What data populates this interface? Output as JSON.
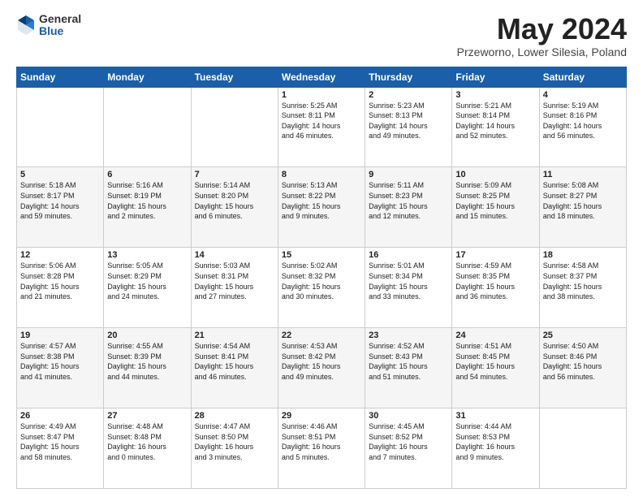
{
  "header": {
    "logo_general": "General",
    "logo_blue": "Blue",
    "month": "May 2024",
    "location": "Przeworno, Lower Silesia, Poland"
  },
  "weekdays": [
    "Sunday",
    "Monday",
    "Tuesday",
    "Wednesday",
    "Thursday",
    "Friday",
    "Saturday"
  ],
  "weeks": [
    [
      {
        "day": "",
        "info": ""
      },
      {
        "day": "",
        "info": ""
      },
      {
        "day": "",
        "info": ""
      },
      {
        "day": "1",
        "info": "Sunrise: 5:25 AM\nSunset: 8:11 PM\nDaylight: 14 hours\nand 46 minutes."
      },
      {
        "day": "2",
        "info": "Sunrise: 5:23 AM\nSunset: 8:13 PM\nDaylight: 14 hours\nand 49 minutes."
      },
      {
        "day": "3",
        "info": "Sunrise: 5:21 AM\nSunset: 8:14 PM\nDaylight: 14 hours\nand 52 minutes."
      },
      {
        "day": "4",
        "info": "Sunrise: 5:19 AM\nSunset: 8:16 PM\nDaylight: 14 hours\nand 56 minutes."
      }
    ],
    [
      {
        "day": "5",
        "info": "Sunrise: 5:18 AM\nSunset: 8:17 PM\nDaylight: 14 hours\nand 59 minutes."
      },
      {
        "day": "6",
        "info": "Sunrise: 5:16 AM\nSunset: 8:19 PM\nDaylight: 15 hours\nand 2 minutes."
      },
      {
        "day": "7",
        "info": "Sunrise: 5:14 AM\nSunset: 8:20 PM\nDaylight: 15 hours\nand 6 minutes."
      },
      {
        "day": "8",
        "info": "Sunrise: 5:13 AM\nSunset: 8:22 PM\nDaylight: 15 hours\nand 9 minutes."
      },
      {
        "day": "9",
        "info": "Sunrise: 5:11 AM\nSunset: 8:23 PM\nDaylight: 15 hours\nand 12 minutes."
      },
      {
        "day": "10",
        "info": "Sunrise: 5:09 AM\nSunset: 8:25 PM\nDaylight: 15 hours\nand 15 minutes."
      },
      {
        "day": "11",
        "info": "Sunrise: 5:08 AM\nSunset: 8:27 PM\nDaylight: 15 hours\nand 18 minutes."
      }
    ],
    [
      {
        "day": "12",
        "info": "Sunrise: 5:06 AM\nSunset: 8:28 PM\nDaylight: 15 hours\nand 21 minutes."
      },
      {
        "day": "13",
        "info": "Sunrise: 5:05 AM\nSunset: 8:29 PM\nDaylight: 15 hours\nand 24 minutes."
      },
      {
        "day": "14",
        "info": "Sunrise: 5:03 AM\nSunset: 8:31 PM\nDaylight: 15 hours\nand 27 minutes."
      },
      {
        "day": "15",
        "info": "Sunrise: 5:02 AM\nSunset: 8:32 PM\nDaylight: 15 hours\nand 30 minutes."
      },
      {
        "day": "16",
        "info": "Sunrise: 5:01 AM\nSunset: 8:34 PM\nDaylight: 15 hours\nand 33 minutes."
      },
      {
        "day": "17",
        "info": "Sunrise: 4:59 AM\nSunset: 8:35 PM\nDaylight: 15 hours\nand 36 minutes."
      },
      {
        "day": "18",
        "info": "Sunrise: 4:58 AM\nSunset: 8:37 PM\nDaylight: 15 hours\nand 38 minutes."
      }
    ],
    [
      {
        "day": "19",
        "info": "Sunrise: 4:57 AM\nSunset: 8:38 PM\nDaylight: 15 hours\nand 41 minutes."
      },
      {
        "day": "20",
        "info": "Sunrise: 4:55 AM\nSunset: 8:39 PM\nDaylight: 15 hours\nand 44 minutes."
      },
      {
        "day": "21",
        "info": "Sunrise: 4:54 AM\nSunset: 8:41 PM\nDaylight: 15 hours\nand 46 minutes."
      },
      {
        "day": "22",
        "info": "Sunrise: 4:53 AM\nSunset: 8:42 PM\nDaylight: 15 hours\nand 49 minutes."
      },
      {
        "day": "23",
        "info": "Sunrise: 4:52 AM\nSunset: 8:43 PM\nDaylight: 15 hours\nand 51 minutes."
      },
      {
        "day": "24",
        "info": "Sunrise: 4:51 AM\nSunset: 8:45 PM\nDaylight: 15 hours\nand 54 minutes."
      },
      {
        "day": "25",
        "info": "Sunrise: 4:50 AM\nSunset: 8:46 PM\nDaylight: 15 hours\nand 56 minutes."
      }
    ],
    [
      {
        "day": "26",
        "info": "Sunrise: 4:49 AM\nSunset: 8:47 PM\nDaylight: 15 hours\nand 58 minutes."
      },
      {
        "day": "27",
        "info": "Sunrise: 4:48 AM\nSunset: 8:48 PM\nDaylight: 16 hours\nand 0 minutes."
      },
      {
        "day": "28",
        "info": "Sunrise: 4:47 AM\nSunset: 8:50 PM\nDaylight: 16 hours\nand 3 minutes."
      },
      {
        "day": "29",
        "info": "Sunrise: 4:46 AM\nSunset: 8:51 PM\nDaylight: 16 hours\nand 5 minutes."
      },
      {
        "day": "30",
        "info": "Sunrise: 4:45 AM\nSunset: 8:52 PM\nDaylight: 16 hours\nand 7 minutes."
      },
      {
        "day": "31",
        "info": "Sunrise: 4:44 AM\nSunset: 8:53 PM\nDaylight: 16 hours\nand 9 minutes."
      },
      {
        "day": "",
        "info": ""
      }
    ]
  ]
}
